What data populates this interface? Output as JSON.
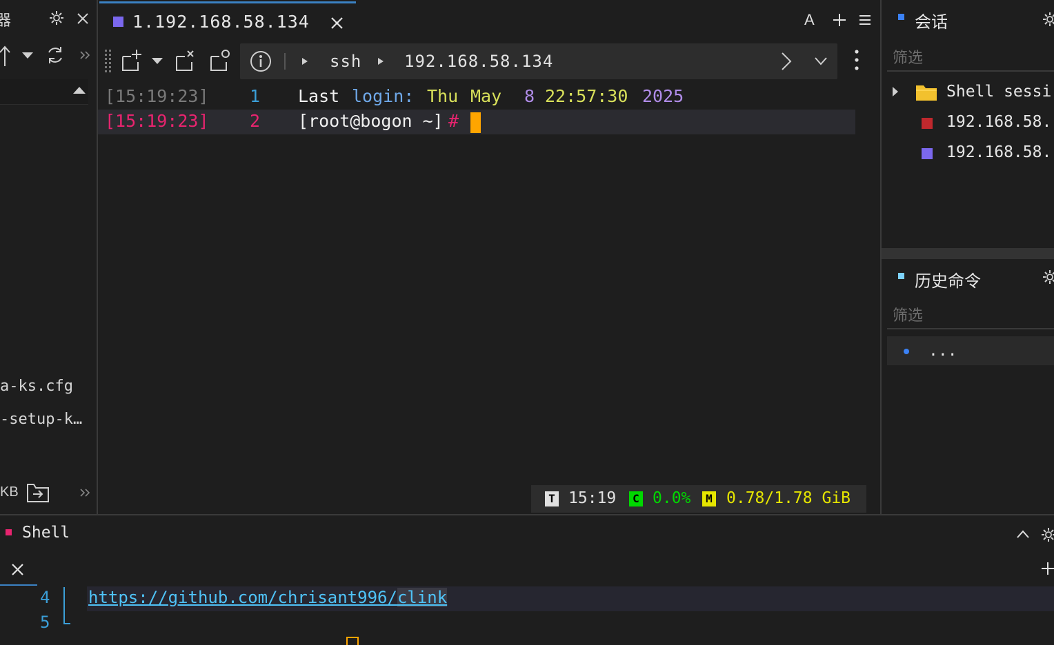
{
  "left_panel": {
    "title_fragment": "器",
    "files": [
      "a-ks.cfg",
      "-setup-k…"
    ],
    "footer_size": "KB"
  },
  "tabs": [
    {
      "label": "1.192.168.58.134",
      "color": "#7b68ee"
    }
  ],
  "tabbar_right": {
    "font_label": "A"
  },
  "breadcrumb": {
    "items": [
      "ssh",
      "192.168.58.134"
    ]
  },
  "terminal": {
    "lines": [
      {
        "time": "[15:19:23]",
        "num": "1",
        "parts": [
          "Last",
          "login:",
          "Thu",
          "May",
          "8",
          "22:57:30",
          "2025"
        ]
      },
      {
        "time": "[15:19:23]",
        "num": "2",
        "prompt": "[root@bogon ~]",
        "hash": "#"
      }
    ]
  },
  "status": {
    "t_badge": "T",
    "time": "15:19",
    "c_badge": "C",
    "cpu": "0.0%",
    "m_badge": "M",
    "mem": "0.78/1.78 GiB"
  },
  "sessions": {
    "title": "会话",
    "filter_placeholder": "筛选",
    "items": [
      {
        "label": "Shell sessi",
        "type": "folder"
      },
      {
        "label": "192.168.58.",
        "color": "#c0282d"
      },
      {
        "label": "192.168.58.",
        "color": "#7b68ee"
      }
    ]
  },
  "history": {
    "title": "历史命令",
    "filter_placeholder": "筛选",
    "items": [
      "..."
    ]
  },
  "bottom": {
    "title": "Shell",
    "editor": {
      "lines": [
        {
          "num": "4",
          "text": "https://github.com/chrisant996/",
          "highlight": "clink"
        },
        {
          "num": "5",
          "text": ""
        }
      ]
    }
  },
  "colors": {
    "accent_blue": "#3b82c4",
    "cursor": "#ffa500",
    "timestamp_error": "#e8246f",
    "cpu_green": "#00d800",
    "mem_yellow": "#e6e600"
  }
}
